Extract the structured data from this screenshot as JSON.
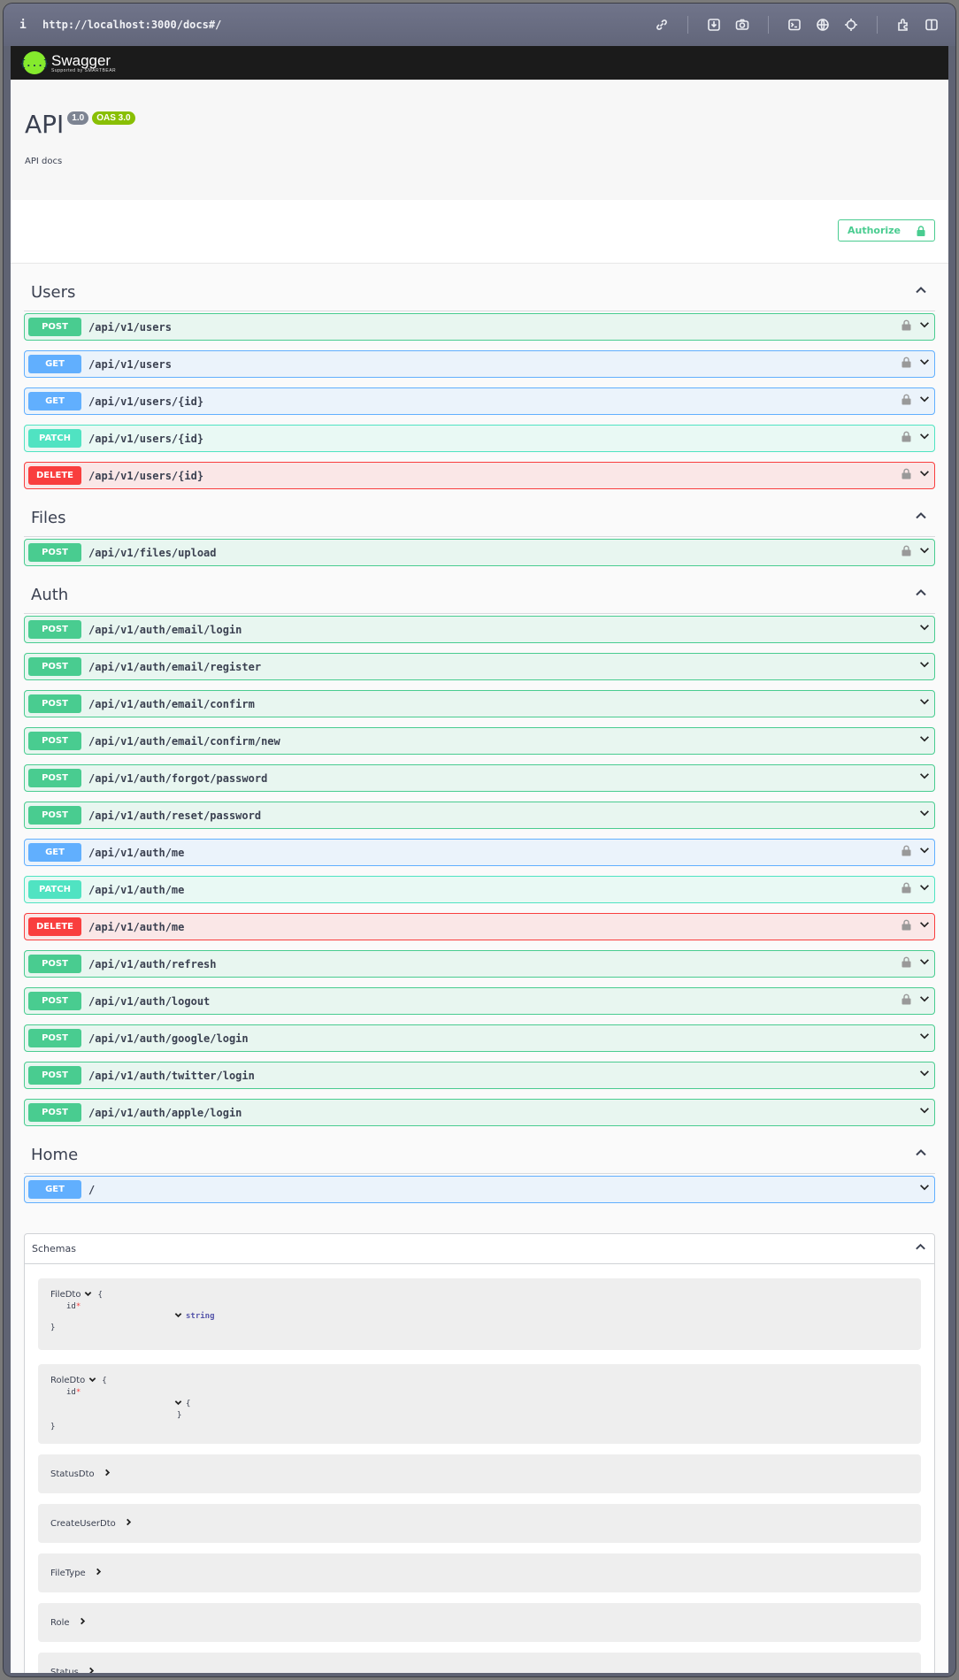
{
  "browser": {
    "info_label": "i",
    "url": "http://localhost:3000/docs#/"
  },
  "header": {
    "logo_glyph": "{...}",
    "logo_name": "Swagger",
    "logo_sub": "Supported by SMARTBEAR"
  },
  "info": {
    "title": "API",
    "version": "1.0",
    "oas": "OAS 3.0",
    "description": "API docs"
  },
  "authorize": {
    "label": "Authorize"
  },
  "tags": [
    {
      "name": "Users",
      "ops": [
        {
          "method": "POST",
          "path": "/api/v1/users",
          "locked": true
        },
        {
          "method": "GET",
          "path": "/api/v1/users",
          "locked": true
        },
        {
          "method": "GET",
          "path": "/api/v1/users/{id}",
          "locked": true
        },
        {
          "method": "PATCH",
          "path": "/api/v1/users/{id}",
          "locked": true
        },
        {
          "method": "DELETE",
          "path": "/api/v1/users/{id}",
          "locked": true
        }
      ]
    },
    {
      "name": "Files",
      "ops": [
        {
          "method": "POST",
          "path": "/api/v1/files/upload",
          "locked": true
        }
      ]
    },
    {
      "name": "Auth",
      "ops": [
        {
          "method": "POST",
          "path": "/api/v1/auth/email/login",
          "locked": false
        },
        {
          "method": "POST",
          "path": "/api/v1/auth/email/register",
          "locked": false
        },
        {
          "method": "POST",
          "path": "/api/v1/auth/email/confirm",
          "locked": false
        },
        {
          "method": "POST",
          "path": "/api/v1/auth/email/confirm/new",
          "locked": false
        },
        {
          "method": "POST",
          "path": "/api/v1/auth/forgot/password",
          "locked": false
        },
        {
          "method": "POST",
          "path": "/api/v1/auth/reset/password",
          "locked": false
        },
        {
          "method": "GET",
          "path": "/api/v1/auth/me",
          "locked": true
        },
        {
          "method": "PATCH",
          "path": "/api/v1/auth/me",
          "locked": true
        },
        {
          "method": "DELETE",
          "path": "/api/v1/auth/me",
          "locked": true
        },
        {
          "method": "POST",
          "path": "/api/v1/auth/refresh",
          "locked": true
        },
        {
          "method": "POST",
          "path": "/api/v1/auth/logout",
          "locked": true
        },
        {
          "method": "POST",
          "path": "/api/v1/auth/google/login",
          "locked": false
        },
        {
          "method": "POST",
          "path": "/api/v1/auth/twitter/login",
          "locked": false
        },
        {
          "method": "POST",
          "path": "/api/v1/auth/apple/login",
          "locked": false
        }
      ]
    },
    {
      "name": "Home",
      "ops": [
        {
          "method": "GET",
          "path": "/",
          "locked": false
        }
      ]
    }
  ],
  "schemas": {
    "title": "Schemas",
    "expanded": [
      {
        "name": "FileDto",
        "open": "{",
        "field": "id",
        "required_mark": "*",
        "type": "string",
        "close": "}"
      },
      {
        "name": "RoleDto",
        "open": "{",
        "field": "id",
        "required_mark": "*",
        "type_open": "{",
        "type_close": "}",
        "close": "}"
      }
    ],
    "collapsed": [
      "StatusDto",
      "CreateUserDto",
      "FileType",
      "Role",
      "Status"
    ]
  },
  "colors": {
    "post": "#49cc90",
    "get": "#61affe",
    "patch": "#50e3c2",
    "delete": "#f93e3e",
    "swagger_green": "#85ea2d"
  }
}
